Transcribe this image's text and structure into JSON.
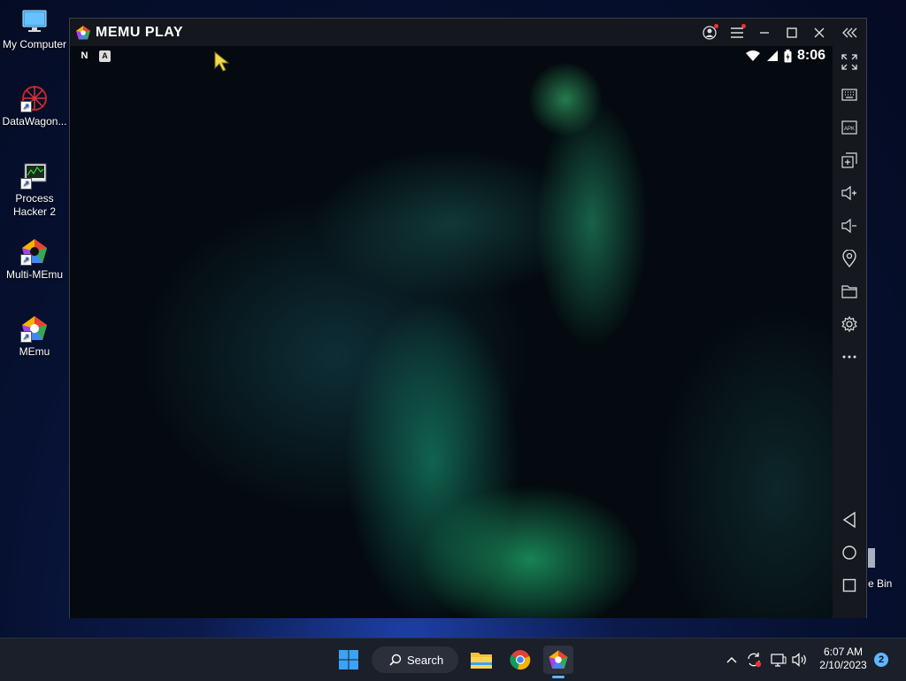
{
  "desktop": {
    "icons": [
      {
        "label": "My Computer"
      },
      {
        "label": "DataWagon..."
      },
      {
        "label": "Process Hacker 2"
      },
      {
        "label": "Multi-MEmu"
      },
      {
        "label": "MEmu"
      }
    ],
    "recycle_bin_partial_label": "e Bin"
  },
  "emulator": {
    "logo_text": "MEMU PLAY",
    "statusbar": {
      "left_icons": [
        "N",
        "A"
      ],
      "time": "8:06"
    },
    "titlebar_buttons": [
      "account-icon",
      "menu-icon",
      "minimize-icon",
      "maximize-icon",
      "close-icon",
      "collapse-sidebar-icon"
    ],
    "sidebar_tools": [
      "fullscreen-icon",
      "keyboard-icon",
      "apk-icon",
      "multi-window-icon",
      "volume-up-icon",
      "volume-down-icon",
      "location-icon",
      "folder-icon",
      "settings-icon",
      "more-icon",
      "back-icon",
      "home-icon",
      "recents-icon"
    ],
    "apk_label": "APK"
  },
  "taskbar": {
    "search_label": "Search",
    "time": "6:07 AM",
    "date": "2/10/2023",
    "notification_count": "2"
  },
  "colors": {
    "accent": "#5fb6ff",
    "taskbar_bg": "#1b1f29",
    "emulator_sidebar": "#15181e"
  }
}
